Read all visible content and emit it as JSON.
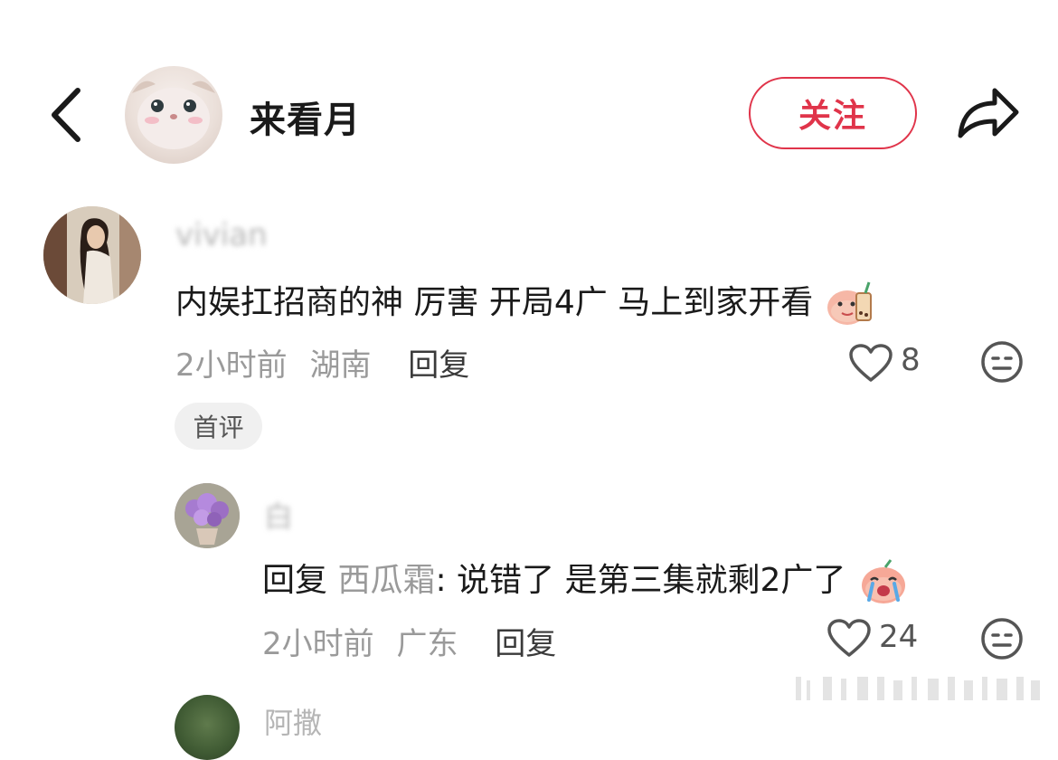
{
  "header": {
    "back_icon": "chevron-left-icon",
    "name": "来看月",
    "follow_label": "关注",
    "share_icon": "share-icon",
    "accent_color": "#e0344a"
  },
  "comments": [
    {
      "username": "vivian",
      "text": "内娱扛招商的神 厉害 开局4广 马上到家开看",
      "time": "2小时前",
      "location": "湖南",
      "reply_label": "回复",
      "likes": "8",
      "badge": "首评",
      "trailing_emoji": "bubble-tea-emoji"
    }
  ],
  "replies": [
    {
      "username": "白",
      "reply_prefix": "回复",
      "reply_target": "西瓜霜",
      "text": ": 说错了 是第三集就剩2广了",
      "time": "2小时前",
      "location": "广东",
      "reply_label": "回复",
      "likes": "24",
      "trailing_emoji": "crying-emoji"
    },
    {
      "username": "阿撒"
    }
  ]
}
